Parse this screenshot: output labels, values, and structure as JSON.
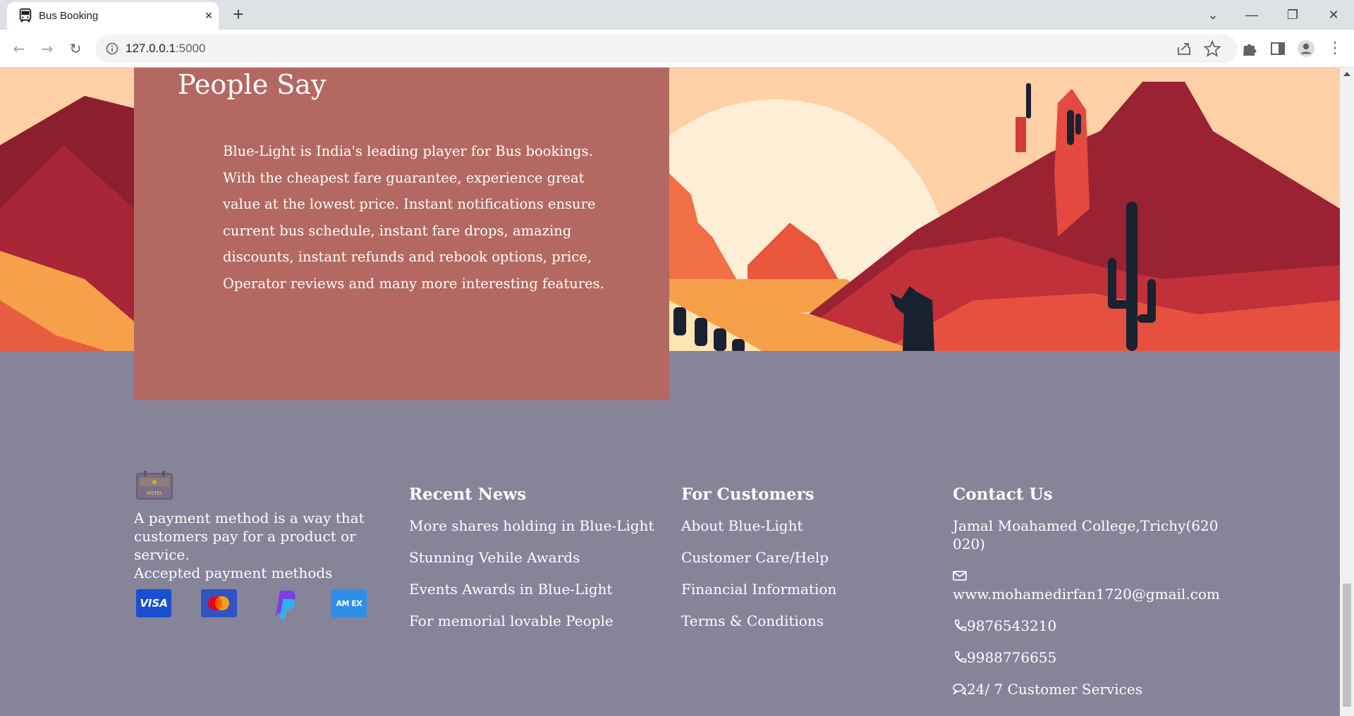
{
  "browser": {
    "tab_title": "Bus Booking",
    "tab_close": "×",
    "new_tab": "+",
    "url_host": "127.0.0.1",
    "url_port": ":5000",
    "controls": {
      "tab_search": "⌄",
      "minimize": "—",
      "restore": "❐",
      "close": "✕"
    }
  },
  "testimonial": {
    "title": "People Say",
    "text": "Blue-Light is India's leading player for Bus bookings. With the cheapest fare guarantee, experience great value at the lowest price. Instant notifications ensure current bus schedule, instant fare drops, amazing discounts, instant refunds and rebook options, price, Operator reviews and many more interesting features."
  },
  "footer": {
    "about": {
      "logo_label": "HOTEL",
      "description": "A payment method is a way that customers pay for a product or service.",
      "payments_label": "Accepted payment methods",
      "payment_methods": [
        {
          "name": "visa-icon",
          "label": "VISA",
          "color": "#1a4fd0"
        },
        {
          "name": "mastercard-icon",
          "label": "",
          "color": "#2f55c4"
        },
        {
          "name": "paypal-icon",
          "label": "",
          "color": "#7a3fe8"
        },
        {
          "name": "amex-icon",
          "label": "AM EX",
          "color": "#2f8fe8"
        }
      ]
    },
    "recent_news": {
      "title": "Recent News",
      "links": [
        "More shares holding in Blue-Light",
        "Stunning Vehile Awards",
        "Events Awards in Blue-Light",
        "For memorial lovable People"
      ]
    },
    "for_customers": {
      "title": "For Customers",
      "links": [
        "About Blue-Light",
        "Customer Care/Help",
        "Financial Information",
        "Terms & Conditions"
      ]
    },
    "contact": {
      "title": "Contact Us",
      "address": "Jamal Moahamed College,Trichy(620 020)",
      "email": "www.mohamedirfan1720@gmail.com",
      "phone1": "9876543210",
      "phone2": "9988776655",
      "service": "24/ 7 Customer Services"
    }
  },
  "colors": {
    "footer_bg": "#868499",
    "quote_bg": "#b36961",
    "sky": "#ffd0a5",
    "sun": "#ffeed6",
    "rock_dark": "#8b1f2e",
    "rock_mid": "#b52a35",
    "rock_light": "#e6513f",
    "sand": "#f7a04a",
    "cactus": "#1a2130"
  }
}
